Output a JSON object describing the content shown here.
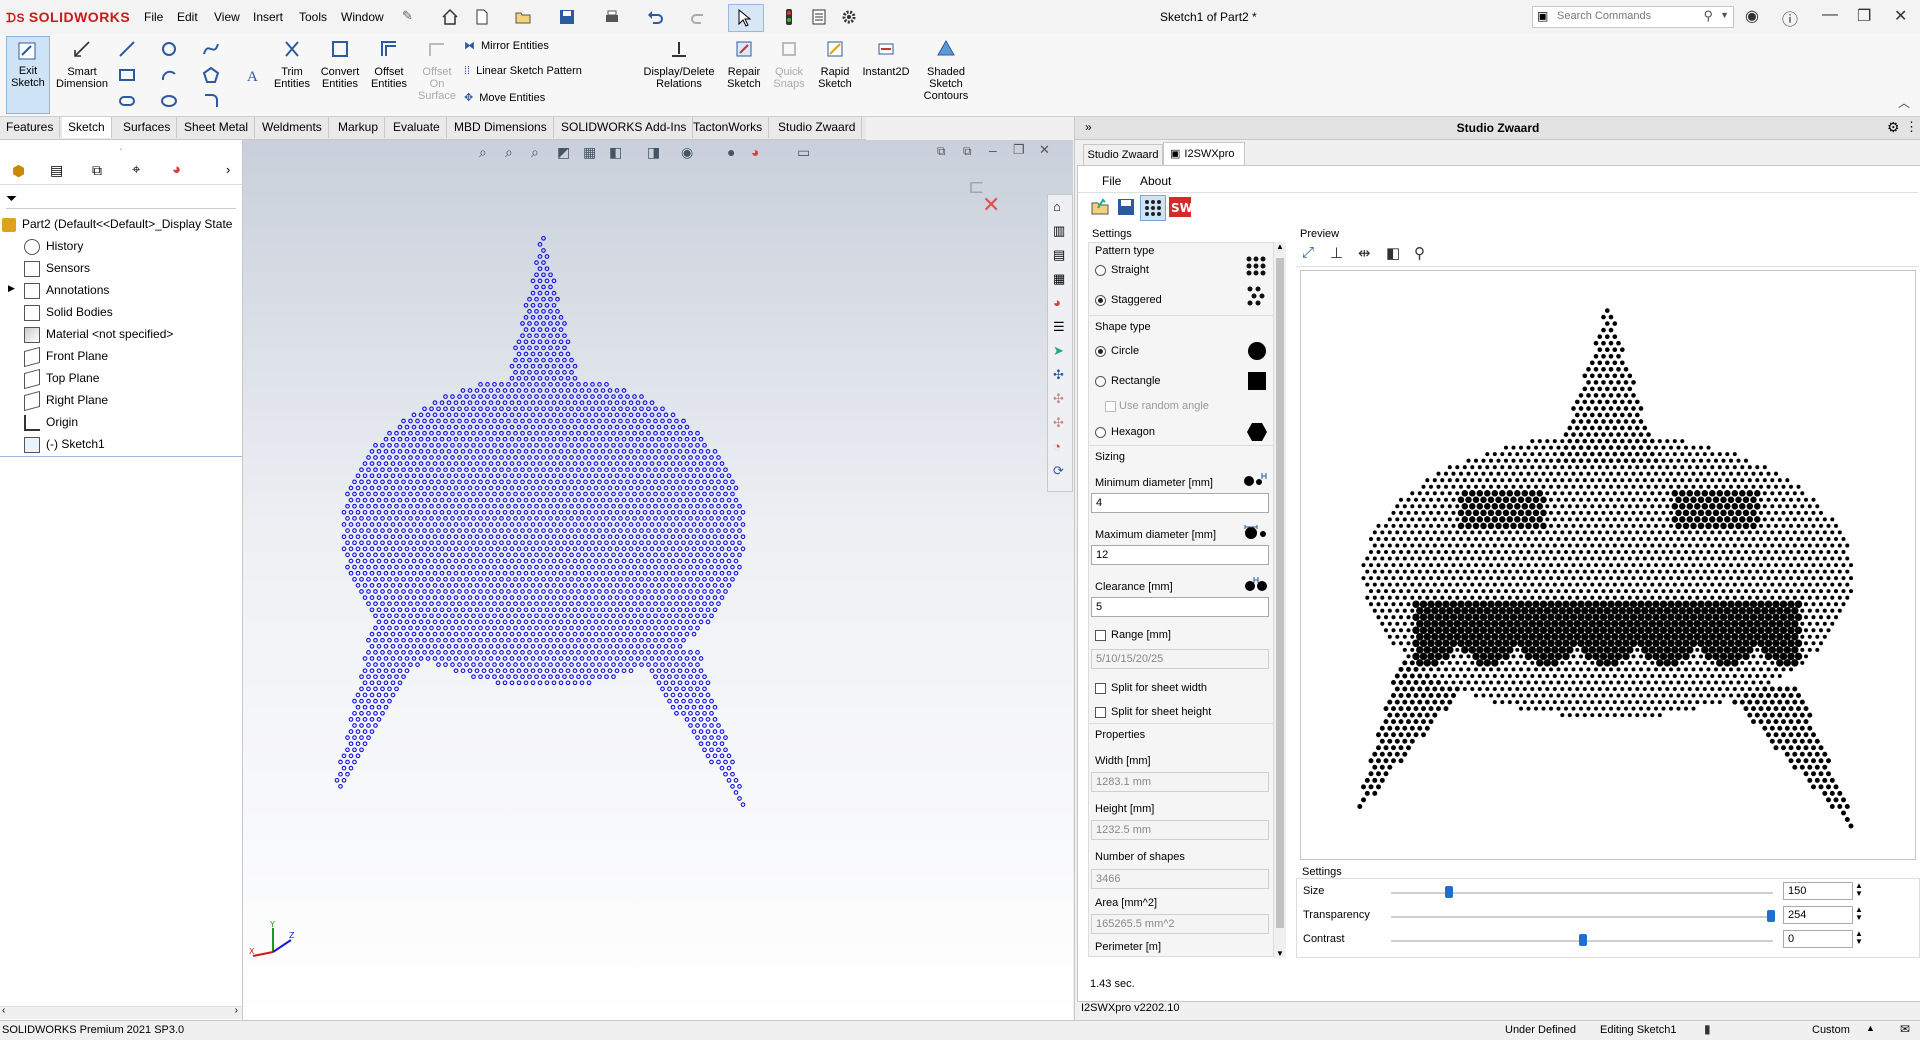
{
  "app": {
    "brand": "SOLIDWORKS",
    "doc_title": "Sketch1 of Part2 *"
  },
  "menu": [
    "File",
    "Edit",
    "View",
    "Insert",
    "Tools",
    "Window"
  ],
  "search": {
    "placeholder": "Search Commands"
  },
  "cmd": {
    "exit_sketch": "Exit Sketch",
    "smart_dimension": "Smart Dimension",
    "trim": "Trim Entities",
    "convert": "Convert Entities",
    "offset": "Offset Entities",
    "offset_surface": "Offset On Surface",
    "mirror": "Mirror Entities",
    "linear_pattern": "Linear Sketch Pattern",
    "move": "Move Entities",
    "display_delete": "Display/Delete Relations",
    "repair": "Repair Sketch",
    "quick_snaps": "Quick Snaps",
    "rapid": "Rapid Sketch",
    "instant2d": "Instant2D",
    "shaded": "Shaded Sketch Contours"
  },
  "tabs": [
    "Features",
    "Sketch",
    "Surfaces",
    "Sheet Metal",
    "Weldments",
    "Markup",
    "Evaluate",
    "MBD Dimensions",
    "SOLIDWORKS Add-Ins",
    "TactonWorks",
    "Studio Zwaard"
  ],
  "tree": {
    "root": "Part2  (Default<<Default>_Display State",
    "items": [
      "History",
      "Sensors",
      "Annotations",
      "Solid Bodies",
      "Material <not specified>",
      "Front Plane",
      "Top Plane",
      "Right Plane",
      "Origin",
      "(-) Sketch1"
    ]
  },
  "panel": {
    "title": "Studio Zwaard",
    "tabs": [
      "Studio Zwaard",
      "I2SWXpro"
    ],
    "menu": [
      "File",
      "About"
    ],
    "settings_title": "Settings",
    "pattern_type": "Pattern type",
    "straight": "Straight",
    "staggered": "Staggered",
    "shape_type": "Shape type",
    "circle": "Circle",
    "rectangle": "Rectangle",
    "random_angle": "Use random angle",
    "hexagon": "Hexagon",
    "sizing": "Sizing",
    "min_diam_label": "Minimum diameter [mm]",
    "min_diam": "4",
    "max_diam_label": "Maximum diameter [mm]",
    "max_diam": "12",
    "clearance_label": "Clearance [mm]",
    "clearance": "5",
    "range_label": "Range [mm]",
    "range": "5/10/15/20/25",
    "split_w": "Split for sheet width",
    "split_h": "Split for sheet height",
    "properties": "Properties",
    "width_label": "Width [mm]",
    "width": "1283.1 mm",
    "height_label": "Height [mm]",
    "height": "1232.5 mm",
    "num_label": "Number of shapes",
    "num": "3466",
    "area_label": "Area [mm^2]",
    "area": "165265.5 mm^2",
    "perim_label": "Perimeter [m]",
    "preview": "Preview",
    "settings2": "Settings",
    "size_label": "Size",
    "size": "150",
    "transp_label": "Transparency",
    "transp": "254",
    "contrast_label": "Contrast",
    "contrast": "0",
    "time": "1.43 sec.",
    "version": "I2SWXpro v2202.10"
  },
  "status": {
    "product": "SOLIDWORKS Premium 2021 SP3.0",
    "defined": "Under Defined",
    "editing": "Editing Sketch1",
    "units": "Custom"
  },
  "colors": {
    "sketch_dots": "#1010e0",
    "accent": "#1e6fd0",
    "brand": "#cc1a1a"
  }
}
